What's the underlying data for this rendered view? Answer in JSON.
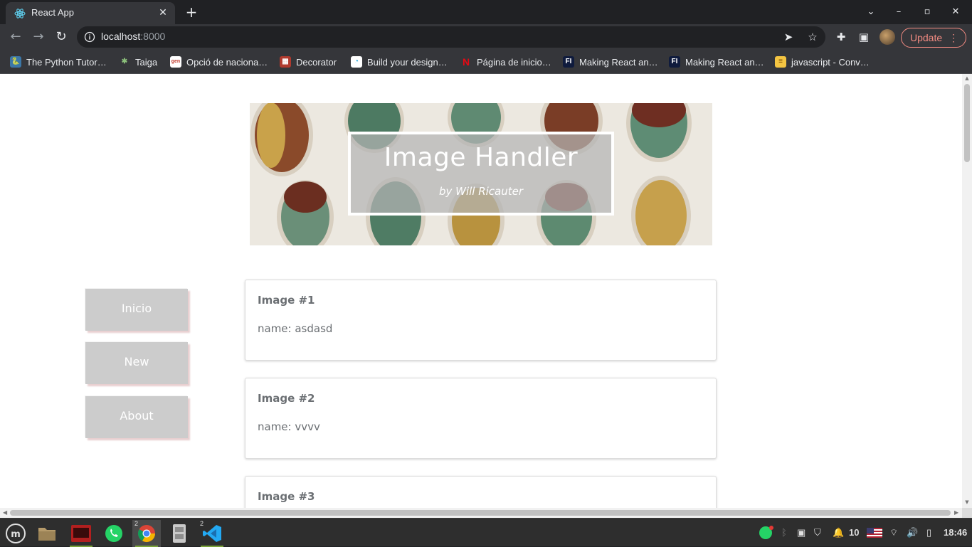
{
  "browser": {
    "tab": {
      "title": "React App",
      "favicon": "react-icon",
      "close": "✕"
    },
    "new_tab": "+",
    "window_controls": {
      "chevron": "⌄",
      "minimize": "–",
      "maximize": "▫",
      "close": "✕"
    },
    "url": {
      "host": "localhost",
      "port": ":8000"
    },
    "update_label": "Update",
    "bookmarks": [
      {
        "label": "The Python Tutor…",
        "icon": "python-icon",
        "color": "#3b77a8"
      },
      {
        "label": "Taiga",
        "icon": "taiga-icon",
        "color": "#5b8c5a"
      },
      {
        "label": "Opció de naciona…",
        "icon": "gencat-icon",
        "color": "#cccccc"
      },
      {
        "label": "Decorator",
        "icon": "decorator-icon",
        "color": "#c0392b"
      },
      {
        "label": "Build your design…",
        "icon": "canva-icon",
        "color": "#18a0d8"
      },
      {
        "label": "Página de inicio…",
        "icon": "netflix-icon",
        "color": "#e50914"
      },
      {
        "label": "Making React an…",
        "icon": "fi-icon",
        "color": "#0f1b3d"
      },
      {
        "label": "Making React an…",
        "icon": "fi-icon",
        "color": "#0f1b3d"
      },
      {
        "label": "javascript - Conv…",
        "icon": "stackoverflow-icon",
        "color": "#f48024"
      }
    ]
  },
  "page": {
    "banner": {
      "title": "Image Handler",
      "subtitle": "by Will Ricauter"
    },
    "nav": [
      {
        "label": "Inicio"
      },
      {
        "label": "New"
      },
      {
        "label": "About"
      }
    ],
    "images": [
      {
        "title": "Image #1",
        "name": "name: asdasd"
      },
      {
        "title": "Image #2",
        "name": "name: vvvv"
      },
      {
        "title": "Image #3",
        "name": ""
      }
    ]
  },
  "taskbar": {
    "chrome_badge": "2",
    "vscode_badge": "2",
    "notification_count": "10",
    "clock": "18:46"
  }
}
